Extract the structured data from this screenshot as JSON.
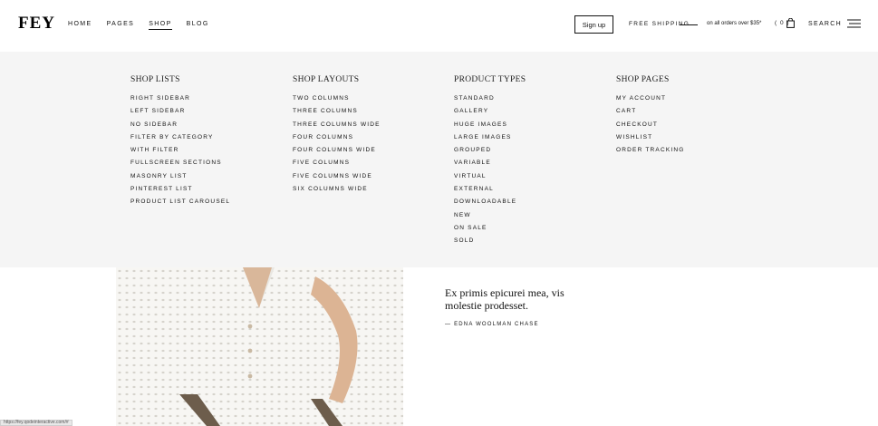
{
  "header": {
    "logo": "FEY",
    "nav": [
      {
        "label": "HOME"
      },
      {
        "label": "PAGES"
      },
      {
        "label": "SHOP"
      },
      {
        "label": "BLOG"
      }
    ],
    "signup_label": "Sign up",
    "free_shipping": "FREE SHIPPING",
    "shipping_note": "on all orders over $35*",
    "cart_count": "( 0 )",
    "search_label": "SEARCH"
  },
  "mega_menu": {
    "columns": [
      {
        "title": "SHOP LISTS",
        "items": [
          "RIGHT SIDEBAR",
          "LEFT SIDEBAR",
          "NO SIDEBAR",
          "FILTER BY CATEGORY",
          "WITH FILTER",
          "FULLSCREEN SECTIONS",
          "MASONRY LIST",
          "PINTEREST LIST",
          "PRODUCT LIST CAROUSEL"
        ]
      },
      {
        "title": "SHOP LAYOUTS",
        "items": [
          "TWO COLUMNS",
          "THREE COLUMNS",
          "THREE COLUMNS WIDE",
          "FOUR COLUMNS",
          "FOUR COLUMNS WIDE",
          "FIVE COLUMNS",
          "FIVE COLUMNS WIDE",
          "SIX COLUMNS WIDE"
        ]
      },
      {
        "title": "PRODUCT TYPES",
        "items": [
          "STANDARD",
          "GALLERY",
          "HUGE IMAGES",
          "LARGE IMAGES",
          "GROUPED",
          "VARIABLE",
          "VIRTUAL",
          "EXTERNAL",
          "DOWNLOADABLE",
          "NEW",
          "ON SALE",
          "SOLD"
        ]
      },
      {
        "title": "SHOP PAGES",
        "items": [
          "MY ACCOUNT",
          "CART",
          "CHECKOUT",
          "WISHLIST",
          "ORDER TRACKING"
        ]
      }
    ]
  },
  "content": {
    "quote": "Ex primis epicurei mea, vis molestie prodesset.",
    "author": "— EDNA WOOLMAN CHASE"
  },
  "status_bar": {
    "url": "https://fey.qodeinteractive.com/#"
  }
}
